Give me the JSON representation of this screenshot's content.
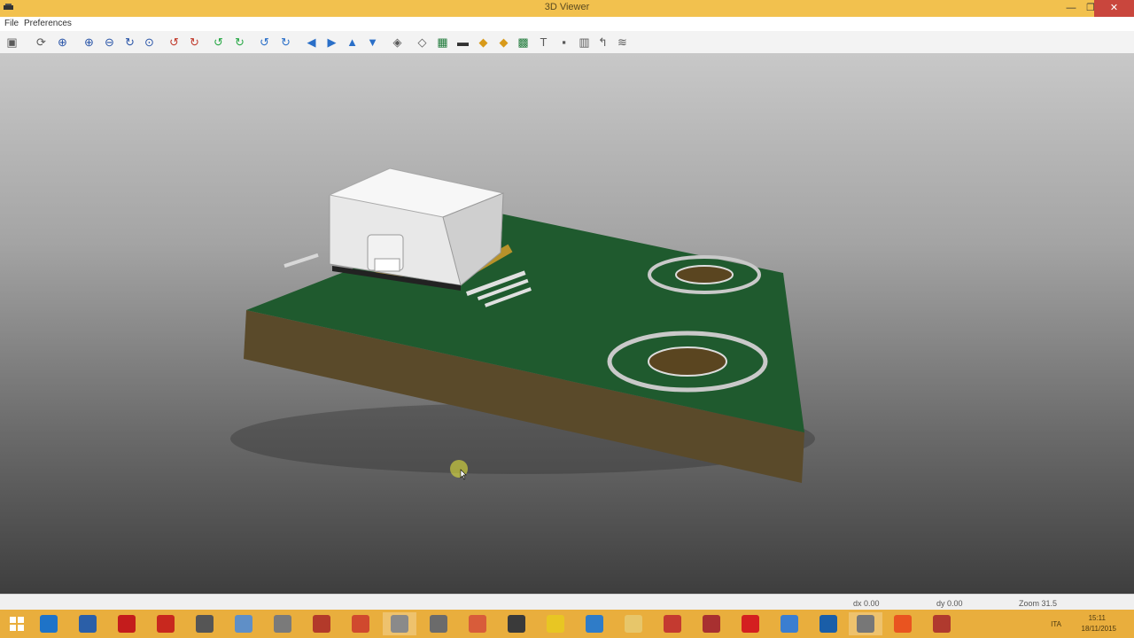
{
  "window": {
    "title": "3D Viewer",
    "minimize_label": "—",
    "maximize_label": "❐",
    "close_label": "✕"
  },
  "menu": {
    "items": [
      {
        "label": "File"
      },
      {
        "label": "Preferences"
      }
    ]
  },
  "toolbar": {
    "buttons": [
      {
        "icon": "3d-view-icon"
      },
      {
        "icon": "reload-icon"
      },
      {
        "icon": "zoom-fit-icon"
      },
      {
        "icon": "zoom-in-icon"
      },
      {
        "icon": "zoom-out-icon"
      },
      {
        "icon": "redraw-icon"
      },
      {
        "icon": "zoom-auto-icon"
      },
      {
        "icon": "rotate-x-cw-icon"
      },
      {
        "icon": "rotate-x-ccw-icon"
      },
      {
        "icon": "rotate-y-cw-icon"
      },
      {
        "icon": "rotate-y-ccw-icon"
      },
      {
        "icon": "rotate-z-cw-icon"
      },
      {
        "icon": "rotate-z-ccw-icon"
      },
      {
        "icon": "pan-left-icon"
      },
      {
        "icon": "pan-right-icon"
      },
      {
        "icon": "pan-up-icon"
      },
      {
        "icon": "pan-down-icon"
      },
      {
        "icon": "orthographic-icon"
      },
      {
        "icon": "realistic-mode-icon"
      },
      {
        "icon": "board-body-icon"
      },
      {
        "icon": "through-hole-icon"
      },
      {
        "icon": "smd-icon"
      },
      {
        "icon": "virtual-icon"
      },
      {
        "icon": "copper-icon"
      },
      {
        "icon": "silkscreen-icon"
      },
      {
        "icon": "solder-mask-icon"
      },
      {
        "icon": "solder-paste-icon"
      },
      {
        "icon": "comments-icon"
      },
      {
        "icon": "eco-layers-icon"
      }
    ]
  },
  "status": {
    "dx": "dx 0.00",
    "dy": "dy 0.00",
    "zoom": "Zoom 31.5"
  },
  "taskbar": {
    "apps": [
      {
        "icon": "internet-explorer-icon",
        "color": "#1e73c8"
      },
      {
        "icon": "network-app-icon",
        "color": "#2b5fa8"
      },
      {
        "icon": "red-app-icon",
        "color": "#c41c1c"
      },
      {
        "icon": "filezilla-icon",
        "color": "#c8281e"
      },
      {
        "icon": "terminal-app-icon",
        "color": "#555555"
      },
      {
        "icon": "document-icon",
        "color": "#5f8fc7"
      },
      {
        "icon": "tools-app-icon",
        "color": "#7a7a7a"
      },
      {
        "icon": "schematic-app-icon",
        "color": "#b33a2a"
      },
      {
        "icon": "pdf-reader-icon",
        "color": "#d0492e"
      },
      {
        "icon": "editor-icon",
        "color": "#8a8a8a"
      },
      {
        "icon": "paper-plane-icon",
        "color": "#6b6b6b"
      },
      {
        "icon": "chip-app-icon",
        "color": "#d85c3a"
      },
      {
        "icon": "pcb-app-icon",
        "color": "#3a3a3a"
      },
      {
        "icon": "puzzle-app-icon",
        "color": "#e8c623"
      },
      {
        "icon": "box-app-icon",
        "color": "#2f7cc8"
      },
      {
        "icon": "folder-icon",
        "color": "#e7c66a"
      },
      {
        "icon": "gear-app-icon",
        "color": "#c43a30"
      },
      {
        "icon": "cube-app-icon",
        "color": "#a83030"
      },
      {
        "icon": "acrobat-icon",
        "color": "#d42020"
      },
      {
        "icon": "notes-app-icon",
        "color": "#3b7ed0"
      },
      {
        "icon": "firefox-icon",
        "color": "#1a5ea8"
      },
      {
        "icon": "viewer-3d-icon",
        "color": "#777777"
      },
      {
        "icon": "ubuntu-icon",
        "color": "#e95420"
      },
      {
        "icon": "kicad-gear-icon",
        "color": "#b03a2e"
      }
    ],
    "tray": {
      "language": "ITA",
      "time": "15:11",
      "date": "18/11/2015"
    }
  }
}
